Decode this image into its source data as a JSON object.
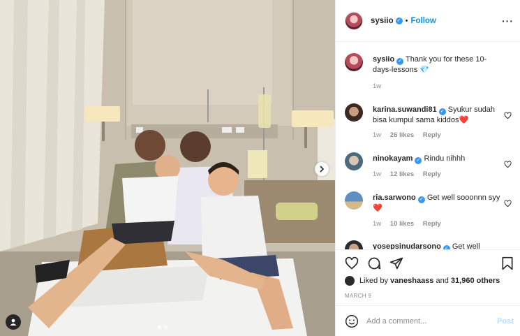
{
  "post": {
    "username": "sysiio",
    "follow_label": "Follow",
    "caption": "Thank you for these 10-days-lessons",
    "caption_emoji": "💎",
    "caption_time": "1w"
  },
  "comments": [
    {
      "username": "karina.suwandi81",
      "text": "Syukur sudah bisa kumpul sama kiddos",
      "emoji": "❤️",
      "time": "1w",
      "likes": "26 likes",
      "reply": "Reply"
    },
    {
      "username": "ninokayam",
      "text": "Rindu nihhh",
      "emoji": "",
      "time": "1w",
      "likes": "12 likes",
      "reply": "Reply"
    },
    {
      "username": "ria.sarwono",
      "text": "Get well sooonnn syy",
      "emoji": "❤️",
      "time": "1w",
      "likes": "10 likes",
      "reply": "Reply"
    },
    {
      "username": "yosepsinudarsono",
      "text": "Get well",
      "emoji": "",
      "time": "",
      "likes": "",
      "reply": ""
    }
  ],
  "likes": {
    "prefix": "Liked by",
    "user": "vaneshaass",
    "connector": "and",
    "others": "31,960 others"
  },
  "date": "MARCH 9",
  "comment_box": {
    "placeholder": "Add a comment...",
    "post_label": "Post"
  },
  "icons": [
    "heart-icon",
    "comment-icon",
    "share-icon",
    "bookmark-icon",
    "emoji-icon",
    "more-icon",
    "chevron-right-icon",
    "user-tag-icon",
    "verified-icon"
  ],
  "colors": {
    "link": "#0095f6",
    "verified": "#3897f0",
    "muted": "#8e8e8e",
    "post_disabled": "#b2dffc",
    "heart_red": "#ed4956"
  }
}
